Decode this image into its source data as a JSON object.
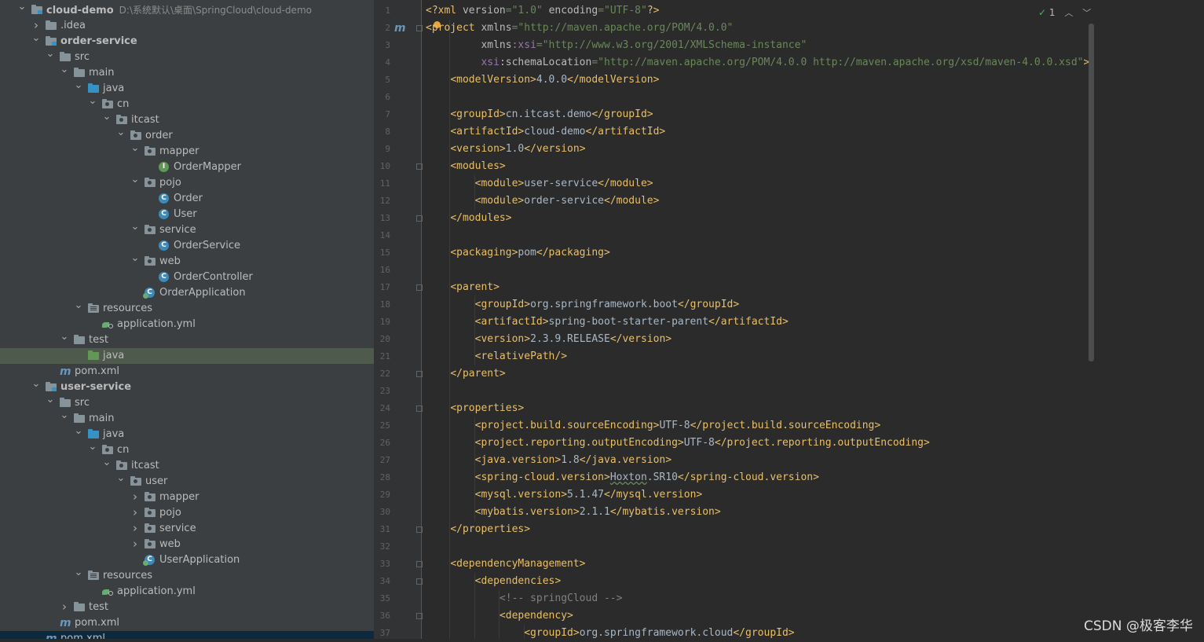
{
  "project_tree": {
    "root": {
      "label": "cloud-demo",
      "path": "D:\\系统默认\\桌面\\SpringCloud\\cloud-demo"
    },
    "rows": [
      {
        "label": "cloud-demo",
        "arrow": "open",
        "icon": "module-folder-icon",
        "bold": true,
        "has_path": true
      },
      {
        "label": ".idea",
        "arrow": "closed",
        "icon": "folder-icon"
      },
      {
        "label": "order-service",
        "arrow": "open",
        "icon": "module-folder-icon",
        "bold": true
      },
      {
        "label": "src",
        "arrow": "open",
        "icon": "folder-icon"
      },
      {
        "label": "main",
        "arrow": "open",
        "icon": "folder-icon"
      },
      {
        "label": "java",
        "arrow": "open",
        "icon": "source-folder-icon"
      },
      {
        "label": "cn",
        "arrow": "open",
        "icon": "package-icon"
      },
      {
        "label": "itcast",
        "arrow": "open",
        "icon": "package-icon"
      },
      {
        "label": "order",
        "arrow": "open",
        "icon": "package-icon"
      },
      {
        "label": "mapper",
        "arrow": "open",
        "icon": "package-icon"
      },
      {
        "label": "OrderMapper",
        "arrow": "none",
        "icon": "interface-icon"
      },
      {
        "label": "pojo",
        "arrow": "open",
        "icon": "package-icon"
      },
      {
        "label": "Order",
        "arrow": "none",
        "icon": "class-icon"
      },
      {
        "label": "User",
        "arrow": "none",
        "icon": "class-icon"
      },
      {
        "label": "service",
        "arrow": "open",
        "icon": "package-icon"
      },
      {
        "label": "OrderService",
        "arrow": "none",
        "icon": "class-icon"
      },
      {
        "label": "web",
        "arrow": "open",
        "icon": "package-icon"
      },
      {
        "label": "OrderController",
        "arrow": "none",
        "icon": "class-icon"
      },
      {
        "label": "OrderApplication",
        "arrow": "none",
        "icon": "spring-app-icon"
      },
      {
        "label": "resources",
        "arrow": "open",
        "icon": "resources-folder-icon"
      },
      {
        "label": "application.yml",
        "arrow": "none",
        "icon": "yml-icon"
      },
      {
        "label": "test",
        "arrow": "open",
        "icon": "folder-icon"
      },
      {
        "label": "java",
        "arrow": "none",
        "icon": "test-folder-icon",
        "selected": true
      },
      {
        "label": "pom.xml",
        "arrow": "none",
        "icon": "maven-icon"
      },
      {
        "label": "user-service",
        "arrow": "open",
        "icon": "module-folder-icon",
        "bold": true
      },
      {
        "label": "src",
        "arrow": "open",
        "icon": "folder-icon"
      },
      {
        "label": "main",
        "arrow": "open",
        "icon": "folder-icon"
      },
      {
        "label": "java",
        "arrow": "open",
        "icon": "source-folder-icon"
      },
      {
        "label": "cn",
        "arrow": "open",
        "icon": "package-icon"
      },
      {
        "label": "itcast",
        "arrow": "open",
        "icon": "package-icon"
      },
      {
        "label": "user",
        "arrow": "open",
        "icon": "package-icon"
      },
      {
        "label": "mapper",
        "arrow": "closed",
        "icon": "package-icon"
      },
      {
        "label": "pojo",
        "arrow": "closed",
        "icon": "package-icon"
      },
      {
        "label": "service",
        "arrow": "closed",
        "icon": "package-icon"
      },
      {
        "label": "web",
        "arrow": "closed",
        "icon": "package-icon"
      },
      {
        "label": "UserApplication",
        "arrow": "none",
        "icon": "spring-app-icon"
      },
      {
        "label": "resources",
        "arrow": "open",
        "icon": "resources-folder-icon"
      },
      {
        "label": "application.yml",
        "arrow": "none",
        "icon": "yml-icon"
      },
      {
        "label": "test",
        "arrow": "closed",
        "icon": "folder-icon"
      },
      {
        "label": "pom.xml",
        "arrow": "none",
        "icon": "maven-icon"
      },
      {
        "label": "pom.xml",
        "arrow": "none",
        "icon": "maven-icon",
        "bottom": true
      }
    ]
  },
  "editor": {
    "inspection_count": "1",
    "lines": [
      [
        [
          "tg",
          "<?xml "
        ],
        [
          "at",
          "version"
        ],
        [
          "st",
          "=\"1.0\" "
        ],
        [
          "at",
          "encoding"
        ],
        [
          "st",
          "=\"UTF-8\""
        ],
        [
          "tg",
          "?>"
        ]
      ],
      [
        [
          "tg",
          "<project "
        ],
        [
          "at",
          "xmlns"
        ],
        [
          "st",
          "=\"http://maven.apache.org/POM/4.0.0\""
        ]
      ],
      [
        [
          "tx",
          "         "
        ],
        [
          "at",
          "xmlns"
        ],
        [
          "ns",
          ":xsi"
        ],
        [
          "st",
          "=\"http://www.w3.org/2001/XMLSchema-instance\""
        ]
      ],
      [
        [
          "tx",
          "         "
        ],
        [
          "ns",
          "xsi"
        ],
        [
          "at",
          ":schemaLocation"
        ],
        [
          "st",
          "=\"http://maven.apache.org/POM/4.0.0 http://maven.apache.org/xsd/maven-4.0.0.xsd\""
        ],
        [
          "tg",
          ">"
        ]
      ],
      [
        [
          "tx",
          "    "
        ],
        [
          "tg",
          "<modelVersion>"
        ],
        [
          "tx",
          "4.0.0"
        ],
        [
          "tg",
          "</modelVersion>"
        ]
      ],
      [],
      [
        [
          "tx",
          "    "
        ],
        [
          "tg",
          "<groupId>"
        ],
        [
          "tx",
          "cn.itcast.demo"
        ],
        [
          "tg",
          "</groupId>"
        ]
      ],
      [
        [
          "tx",
          "    "
        ],
        [
          "tg",
          "<artifactId>"
        ],
        [
          "tx",
          "cloud-demo"
        ],
        [
          "tg",
          "</artifactId>"
        ]
      ],
      [
        [
          "tx",
          "    "
        ],
        [
          "tg",
          "<version>"
        ],
        [
          "tx",
          "1.0"
        ],
        [
          "tg",
          "</version>"
        ]
      ],
      [
        [
          "tx",
          "    "
        ],
        [
          "tg",
          "<modules>"
        ]
      ],
      [
        [
          "tx",
          "        "
        ],
        [
          "tg",
          "<module>"
        ],
        [
          "tx",
          "user-service"
        ],
        [
          "tg",
          "</module>"
        ]
      ],
      [
        [
          "tx",
          "        "
        ],
        [
          "tg",
          "<module>"
        ],
        [
          "tx",
          "order-service"
        ],
        [
          "tg",
          "</module>"
        ]
      ],
      [
        [
          "tx",
          "    "
        ],
        [
          "tg",
          "</modules>"
        ]
      ],
      [],
      [
        [
          "tx",
          "    "
        ],
        [
          "tg",
          "<packaging>"
        ],
        [
          "tx",
          "pom"
        ],
        [
          "tg",
          "</packaging>"
        ]
      ],
      [],
      [
        [
          "tx",
          "    "
        ],
        [
          "tg",
          "<parent>"
        ]
      ],
      [
        [
          "tx",
          "        "
        ],
        [
          "tg",
          "<groupId>"
        ],
        [
          "tx",
          "org.springframework.boot"
        ],
        [
          "tg",
          "</groupId>"
        ]
      ],
      [
        [
          "tx",
          "        "
        ],
        [
          "tg",
          "<artifactId>"
        ],
        [
          "tx",
          "spring-boot-starter-parent"
        ],
        [
          "tg",
          "</artifactId>"
        ]
      ],
      [
        [
          "tx",
          "        "
        ],
        [
          "tg",
          "<version>"
        ],
        [
          "tx",
          "2.3.9.RELEASE"
        ],
        [
          "tg",
          "</version>"
        ]
      ],
      [
        [
          "tx",
          "        "
        ],
        [
          "tg",
          "<relativePath/>"
        ]
      ],
      [
        [
          "tx",
          "    "
        ],
        [
          "tg",
          "</parent>"
        ]
      ],
      [],
      [
        [
          "tx",
          "    "
        ],
        [
          "tg",
          "<properties>"
        ]
      ],
      [
        [
          "tx",
          "        "
        ],
        [
          "tg",
          "<project.build.sourceEncoding>"
        ],
        [
          "tx",
          "UTF-8"
        ],
        [
          "tg",
          "</project.build.sourceEncoding>"
        ]
      ],
      [
        [
          "tx",
          "        "
        ],
        [
          "tg",
          "<project.reporting.outputEncoding>"
        ],
        [
          "tx",
          "UTF-8"
        ],
        [
          "tg",
          "</project.reporting.outputEncoding>"
        ]
      ],
      [
        [
          "tx",
          "        "
        ],
        [
          "tg",
          "<java.version>"
        ],
        [
          "tx",
          "1.8"
        ],
        [
          "tg",
          "</java.version>"
        ]
      ],
      [
        [
          "tx",
          "        "
        ],
        [
          "tg",
          "<spring-cloud.version>"
        ],
        [
          "wv",
          "Hoxton"
        ],
        [
          "tx",
          ".SR10"
        ],
        [
          "tg",
          "</spring-cloud.version>"
        ]
      ],
      [
        [
          "tx",
          "        "
        ],
        [
          "tg",
          "<mysql.version>"
        ],
        [
          "tx",
          "5.1.47"
        ],
        [
          "tg",
          "</mysql.version>"
        ]
      ],
      [
        [
          "tx",
          "        "
        ],
        [
          "tg",
          "<mybatis.version>"
        ],
        [
          "tx",
          "2.1.1"
        ],
        [
          "tg",
          "</mybatis.version>"
        ]
      ],
      [
        [
          "tx",
          "    "
        ],
        [
          "tg",
          "</properties>"
        ]
      ],
      [],
      [
        [
          "tx",
          "    "
        ],
        [
          "tg",
          "<dependencyManagement>"
        ]
      ],
      [
        [
          "tx",
          "        "
        ],
        [
          "tg",
          "<dependencies>"
        ]
      ],
      [
        [
          "tx",
          "            "
        ],
        [
          "cm",
          "<!-- springCloud -->"
        ]
      ],
      [
        [
          "tx",
          "            "
        ],
        [
          "tg",
          "<dependency>"
        ]
      ],
      [
        [
          "tx",
          "                "
        ],
        [
          "tg",
          "<groupId>"
        ],
        [
          "tx",
          "org.springframework.cloud"
        ],
        [
          "tg",
          "</groupId>"
        ]
      ]
    ],
    "fold_lines": [
      2,
      10,
      13,
      17,
      22,
      24,
      31,
      33,
      34,
      36
    ]
  },
  "watermark": "CSDN @极客李华"
}
